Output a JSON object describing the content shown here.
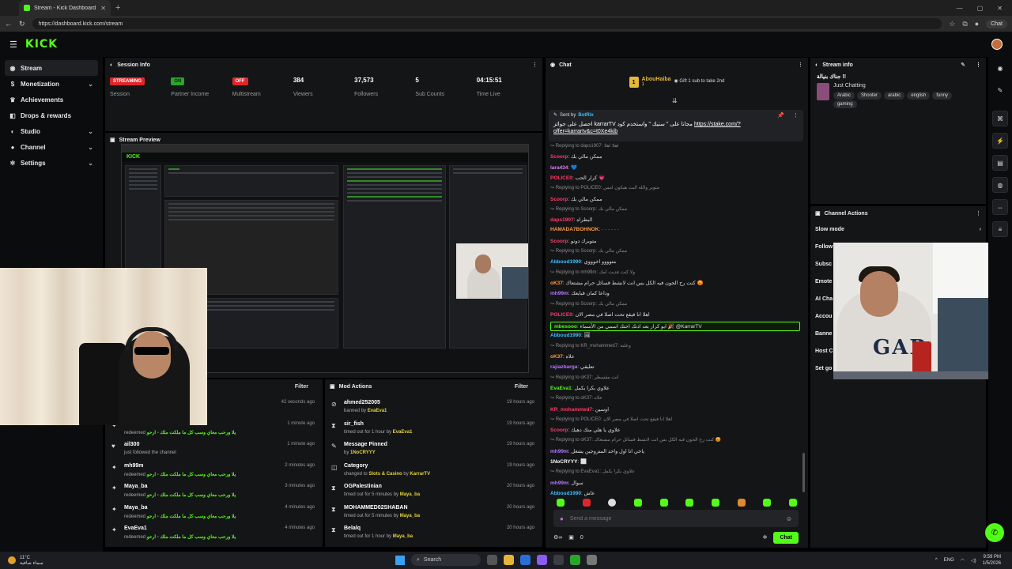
{
  "browser": {
    "tab_title": "Stream - Kick Dashboard",
    "url": "https://dashboard.kick.com/stream",
    "chat_label": "Chat"
  },
  "app": {
    "logo": "KICK"
  },
  "sidebar": {
    "items": [
      {
        "label": "Stream",
        "icon": "broadcast-icon",
        "glyph": "◉",
        "chevron": ""
      },
      {
        "label": "Monetization",
        "icon": "dollar-icon",
        "glyph": "$",
        "chevron": "⌄"
      },
      {
        "label": "Achievements",
        "icon": "trophy-icon",
        "glyph": "♛",
        "chevron": ""
      },
      {
        "label": "Drops & rewards",
        "icon": "gift-icon",
        "glyph": "◧",
        "chevron": ""
      },
      {
        "label": "Studio",
        "icon": "studio-icon",
        "glyph": "◐",
        "chevron": "⌄"
      },
      {
        "label": "Channel",
        "icon": "user-icon",
        "glyph": "●",
        "chevron": "⌄"
      },
      {
        "label": "Settings",
        "icon": "gear-icon",
        "glyph": "✲",
        "chevron": "⌄"
      }
    ]
  },
  "session_info": {
    "title": "Session Info",
    "stats": [
      {
        "value": "STREAMING",
        "label": "Session",
        "badge": "red"
      },
      {
        "value": "ON",
        "label": "Partner Income",
        "badge": "green"
      },
      {
        "value": "OFF",
        "label": "Multistream",
        "badge": "red"
      },
      {
        "value": "384",
        "label": "Viewers",
        "badge": ""
      },
      {
        "value": "37,573",
        "label": "Followers",
        "badge": ""
      },
      {
        "value": "5",
        "label": "Sub Counts",
        "badge": ""
      },
      {
        "value": "04:15:51",
        "label": "Time Live",
        "badge": ""
      }
    ]
  },
  "stream_preview": {
    "title": "Stream Preview"
  },
  "activity_feed": {
    "filter": "Filter",
    "items": [
      {
        "user": "",
        "desc": "",
        "time": "42 seconds ago",
        "icon": "sparkle-icon",
        "glyph": "✦"
      },
      {
        "user": "",
        "desc_prefix": "redeemed",
        "desc_reward": "يلا ورحب معاي وسب كل ما ملكت ملك - ارحو",
        "time": "1 minute ago",
        "icon": "sparkle-icon",
        "glyph": "✦"
      },
      {
        "user": "ail300",
        "desc": "just followed the channel",
        "time": "1 minute ago",
        "icon": "heart-icon",
        "glyph": "♥"
      },
      {
        "user": "mh99m",
        "desc_prefix": "redeemed",
        "desc_reward": "يلا ورحب معاي وسب كل ما ملكت ملك - ارحو",
        "time": "2 minutes ago",
        "icon": "sparkle-icon",
        "glyph": "✦"
      },
      {
        "user": "Maya_ba",
        "desc_prefix": "redeemed",
        "desc_reward": "يلا ورحب معاي وسب كل ما ملكت ملك - ارحو",
        "time": "3 minutes ago",
        "icon": "sparkle-icon",
        "glyph": "✦"
      },
      {
        "user": "Maya_ba",
        "desc_prefix": "redeemed",
        "desc_reward": "يلا ورحب معاي وسب كل ما ملكت ملك - ارحو",
        "time": "4 minutes ago",
        "icon": "sparkle-icon",
        "glyph": "✦"
      },
      {
        "user": "EvaEva1",
        "desc_prefix": "redeemed",
        "desc_reward": "يلا ورحب معاي وسب كل ما ملكت ملك - ارحو",
        "time": "4 minutes ago",
        "icon": "sparkle-icon",
        "glyph": "✦"
      }
    ]
  },
  "mod_actions": {
    "title": "Mod Actions",
    "filter": "Filter",
    "items": [
      {
        "title": "ahmed252005",
        "desc": "banned by",
        "by": "EvaEva1",
        "time": "19 hours ago",
        "icon": "ban-icon",
        "glyph": "⊘"
      },
      {
        "title": "sir_fish",
        "desc": "timed out for 1 hour by",
        "by": "EvaEva1",
        "time": "19 hours ago",
        "icon": "hourglass-icon",
        "glyph": "⧗"
      },
      {
        "title": "Message Pinned",
        "desc": "by",
        "by": "1NoCRYYY",
        "time": "19 hours ago",
        "icon": "pin-icon",
        "glyph": "✎"
      },
      {
        "title": "Category",
        "desc": "changed to",
        "by": "Slots & Casino",
        "extra": "by",
        "extra_by": "KarrarTV",
        "time": "19 hours ago",
        "icon": "category-icon",
        "glyph": "◫"
      },
      {
        "title": "OGPalestinian",
        "desc": "timed out for 5 minutes by",
        "by": "Maya_ba",
        "time": "20 hours ago",
        "icon": "hourglass-icon",
        "glyph": "⧗"
      },
      {
        "title": "MOHAMMED02SHABAN",
        "desc": "timed out for 5 minutes by",
        "by": "Maya_ba",
        "time": "20 hours ago",
        "icon": "hourglass-icon",
        "glyph": "⧗"
      },
      {
        "title": "Belalq",
        "desc": "timed out for 1 hour by",
        "by": "Maya_ba",
        "time": "20 hours ago",
        "icon": "hourglass-icon",
        "glyph": "⧗"
      }
    ]
  },
  "chat": {
    "title": "Chat",
    "gifter": "AbouHaiba",
    "gifter_count": "1",
    "gift_note": "Gift 1 sub to take 2nd",
    "pinned_sender_prefix": "Sent by",
    "pinned_sender": "BotRix",
    "pinned_text": "احصل على جوائز karrarTV مجانا على \" ستيك \" واستخدم كود",
    "pinned_link": "https://stake.com/?offer=karrartv&c=t0Xe4kib",
    "messages": [
      {
        "type": "reply",
        "text": "↪ Replying to daps1907: اهلا اهلا"
      },
      {
        "type": "msg",
        "user": "Scoorp",
        "color": "#ff3b6b",
        "text": "ممكن مالي بك"
      },
      {
        "type": "msg",
        "user": "lara434",
        "color": "#e27ff0",
        "text": "💙"
      },
      {
        "type": "msg",
        "user": "POLICE0",
        "color": "#ff3b6b",
        "text": "كرار الحب 💗"
      },
      {
        "type": "reply",
        "text": "↪ Replying to POLICE0: متوبر والله البث هيكون امس"
      },
      {
        "type": "msg",
        "user": "Scoorp",
        "color": "#ff3b6b",
        "text": "ممكن مالي بك"
      },
      {
        "type": "reply",
        "text": "↪ Replying to Scoorp: ممكن مالي بك"
      },
      {
        "type": "msg",
        "user": "daps1907",
        "color": "#ff3b6b",
        "text": "البطراه"
      },
      {
        "type": "msg",
        "user": "HAMADA7BOHNOK",
        "color": "#ff9a3d",
        "text": "· · · · · ·"
      },
      {
        "type": "msg",
        "user": "Scoorp",
        "color": "#ff3b6b",
        "text": "متوبرك دونو"
      },
      {
        "type": "reply",
        "text": "↪ Replying to Scoorp: ممكن مالي بك"
      },
      {
        "type": "msg",
        "user": "Abboud1990",
        "color": "#39c1ff",
        "text": "متوووو اخوووي"
      },
      {
        "type": "reply",
        "text": "↪ Replying to mh99m: ولا كنت فديت امك"
      },
      {
        "type": "msg",
        "user": "oK37",
        "color": "#ff9a3d",
        "text": "كنت رح الجون فيه الكل بس انت لانشط قسائل حرام مشتعاك 😡"
      },
      {
        "type": "msg",
        "user": "mh99m",
        "color": "#b877ff",
        "text": "وداعا كمان قبايعك"
      },
      {
        "type": "reply",
        "text": "↪ Replying to Scoorp: ممكن مالي بك"
      },
      {
        "type": "msg",
        "user": "POLICE0",
        "color": "#ff3b6b",
        "text": "اهلا انا فيقع تحت اصلا في مصر الان"
      },
      {
        "type": "highlight",
        "user": "mbesooo",
        "color": "#53fc18",
        "text": "ابو كرار بعد اذنك احتك اسمي من الأسماء 🎉 @KarrarTV"
      },
      {
        "type": "msg",
        "user": "Abboud1990",
        "color": "#39c1ff",
        "text": "🖼"
      },
      {
        "type": "reply",
        "text": "↪ Replying to KR_mohammed7: وعلنه"
      },
      {
        "type": "msg",
        "user": "oK37",
        "color": "#ff9a3d",
        "text": "علاه"
      },
      {
        "type": "msg",
        "user": "rajiazbarga",
        "color": "#b877ff",
        "text": "تعليقي"
      },
      {
        "type": "reply",
        "text": "↪ Replying to oK37: انت مقسطر"
      },
      {
        "type": "msg",
        "user": "EvaEva1",
        "color": "#53fc18",
        "text": "علاوي بكرا بكمل"
      },
      {
        "type": "reply",
        "text": "↪ Replying to oK37: علاه"
      },
      {
        "type": "msg",
        "user": "KR_mohammed7",
        "color": "#ff3b6b",
        "text": "اوسين"
      },
      {
        "type": "reply",
        "text": "↪ Replying to POLICE0: اهلا انا فيقع تحت اصلا في مصر الان"
      },
      {
        "type": "msg",
        "user": "Scoorp",
        "color": "#ff3b6b",
        "text": "علاوي يا هلي منك دهيك"
      },
      {
        "type": "reply",
        "text": "↪ Replying to oK37: كنت رح الجون فيه الكل بس انت لانشط قسائل حرام مشتعاك 😡"
      },
      {
        "type": "msg",
        "user": "mh99m",
        "color": "#b877ff",
        "text": "ياخي انا اول واحد المتزوجين يشغل"
      },
      {
        "type": "msg",
        "user": "1NoCRYYY",
        "color": "#ffffff",
        "text": "⬜"
      },
      {
        "type": "reply",
        "text": "↪ Replying to EvaEva1: علاوي بكرا بكمل"
      },
      {
        "type": "msg",
        "user": "mh99m",
        "color": "#b877ff",
        "text": "سوال"
      },
      {
        "type": "msg",
        "user": "Abboud1990",
        "color": "#39c1ff",
        "text": "عاش"
      }
    ],
    "input_placeholder": "Send a message",
    "points": "0",
    "send_label": "Chat"
  },
  "stream_info": {
    "title": "Stream info",
    "stream_title": "جناك بنيالة !!",
    "category": "Just Chatting",
    "tags": [
      "Arabic",
      "Shooter",
      "arabic",
      "english",
      "funny",
      "gaming"
    ]
  },
  "channel_actions": {
    "title": "Channel Actions",
    "items": [
      "Slow mode",
      "Follow",
      "Subsc",
      "Emote",
      "AI Cha",
      "Accou",
      "Banne",
      "Host C",
      "Set go"
    ]
  },
  "taskbar": {
    "temp": "11°C",
    "weather_text": "سماء صافية",
    "search": "Search",
    "lang": "ENG",
    "time": "9:59 PM",
    "date": "1/5/2026"
  },
  "colors": {
    "accent": "#53fc18",
    "danger": "#e0262b",
    "panel": "#141517"
  }
}
